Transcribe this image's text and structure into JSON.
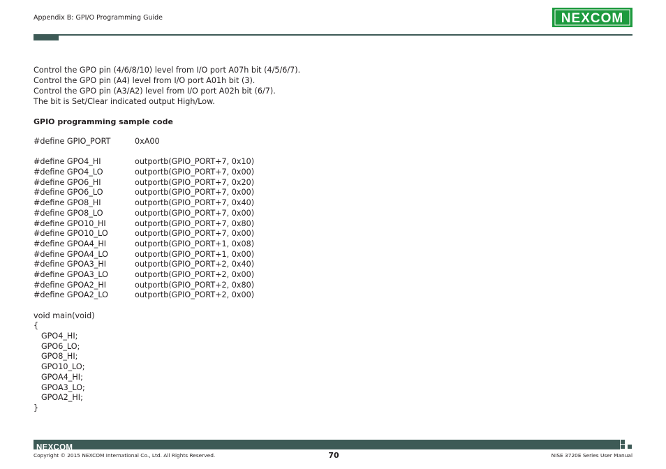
{
  "header": {
    "section_title": "Appendix B: GPI/O Programming Guide",
    "logo_text": "NEXCOM",
    "brand_color": "#1d9a3e",
    "rule_color": "#3d5a56"
  },
  "intro_lines": [
    "Control the GPO pin (4/6/8/10) level from I/O port A07h bit (4/5/6/7).",
    "Control the GPO pin (A4) level from I/O port A01h bit (3).",
    "Control the GPO pin (A3/A2) level from I/O port A02h bit (6/7).",
    "The bit is Set/Clear indicated output High/Low."
  ],
  "sample_heading": "GPIO programming sample code",
  "port_define": {
    "name": "#define GPIO_PORT",
    "value": "0xA00"
  },
  "defines": [
    {
      "name": "#define GPO4_HI",
      "value": "outportb(GPIO_PORT+7, 0x10)"
    },
    {
      "name": "#define GPO4_LO",
      "value": "outportb(GPIO_PORT+7, 0x00)"
    },
    {
      "name": "#define GPO6_HI",
      "value": "outportb(GPIO_PORT+7, 0x20)"
    },
    {
      "name": "#define GPO6_LO",
      "value": "outportb(GPIO_PORT+7, 0x00)"
    },
    {
      "name": "#define GPO8_HI",
      "value": "outportb(GPIO_PORT+7, 0x40)"
    },
    {
      "name": "#define GPO8_LO",
      "value": "outportb(GPIO_PORT+7, 0x00)"
    },
    {
      "name": "#define GPO10_HI",
      "value": "outportb(GPIO_PORT+7, 0x80)"
    },
    {
      "name": "#define GPO10_LO",
      "value": "outportb(GPIO_PORT+7, 0x00)"
    },
    {
      "name": "#define GPOA4_HI",
      "value": "outportb(GPIO_PORT+1, 0x08)"
    },
    {
      "name": "#define GPOA4_LO",
      "value": "outportb(GPIO_PORT+1, 0x00)"
    },
    {
      "name": "#define GPOA3_HI",
      "value": "outportb(GPIO_PORT+2, 0x40)"
    },
    {
      "name": "#define GPOA3_LO",
      "value": "outportb(GPIO_PORT+2, 0x00)"
    },
    {
      "name": "#define GPOA2_HI",
      "value": "outportb(GPIO_PORT+2, 0x80)"
    },
    {
      "name": "#define GPOA2_LO",
      "value": "outportb(GPIO_PORT+2, 0x00)"
    }
  ],
  "main_code": {
    "signature": "void main(void)",
    "open_brace": "{",
    "statements": [
      "GPO4_HI;",
      "GPO6_LO;",
      "GPO8_HI;",
      "GPO10_LO;",
      "GPOA4_HI;",
      "GPOA3_LO;",
      "GPOA2_HI;"
    ],
    "close_brace": "}"
  },
  "footer": {
    "logo_text": "NEXCOM",
    "copyright": "Copyright © 2015 NEXCOM International Co., Ltd. All Rights Reserved.",
    "page_number": "70",
    "manual_title": "NISE 3720E Series User Manual"
  }
}
